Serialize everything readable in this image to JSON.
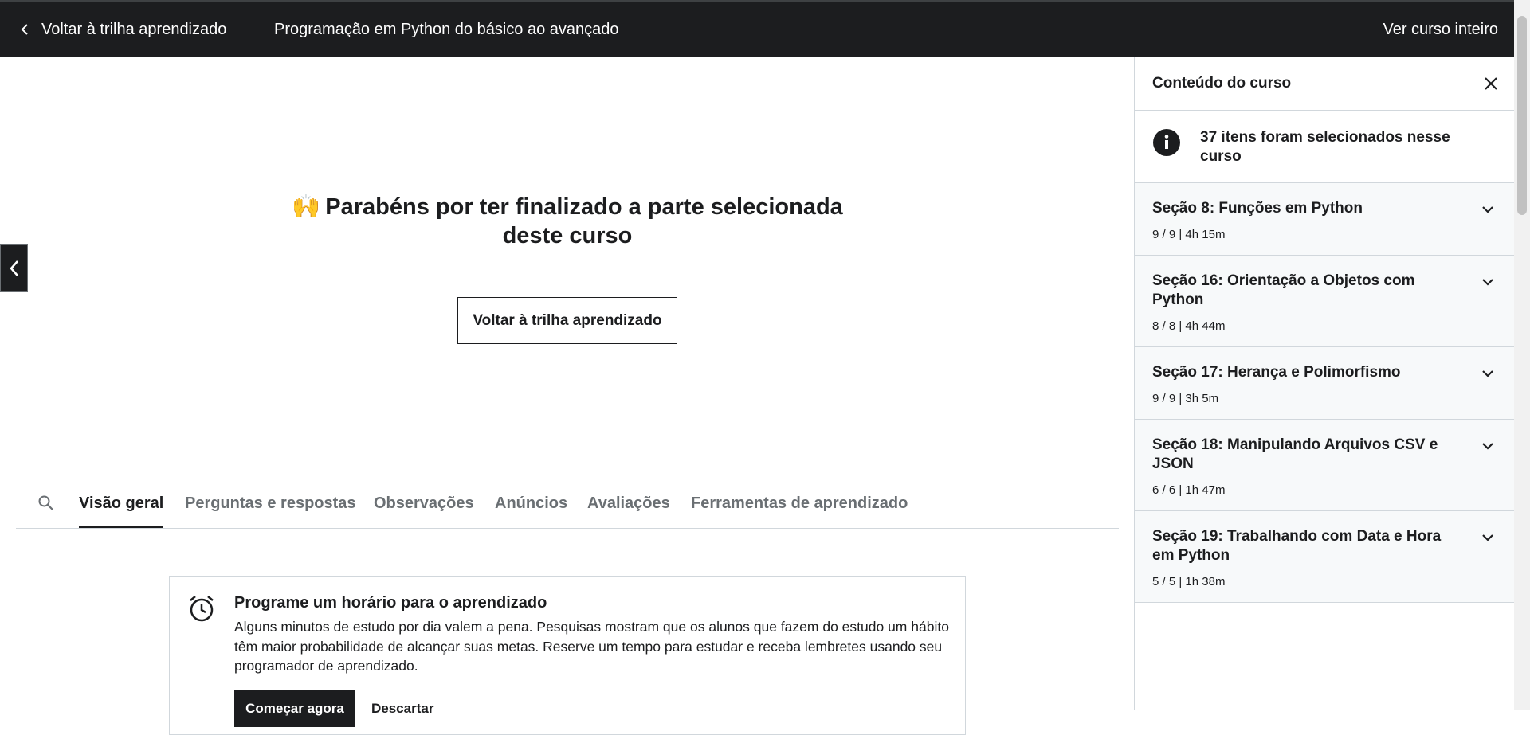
{
  "topbar": {
    "back_label": "Voltar à trilha aprendizado",
    "course_title": "Programação em Python do básico ao avançado",
    "view_all": "Ver curso inteiro"
  },
  "main": {
    "emoji": "🙌",
    "congrats_title": "Parabéns por ter finalizado a parte selecionada deste curso",
    "back_button": "Voltar à trilha aprendizado"
  },
  "tabs": [
    {
      "label": "Visão geral",
      "active": true
    },
    {
      "label": "Perguntas e respostas",
      "active": false
    },
    {
      "label": "Observações",
      "active": false
    },
    {
      "label": "Anúncios",
      "active": false
    },
    {
      "label": "Avaliações",
      "active": false
    },
    {
      "label": "Ferramentas de aprendizado",
      "active": false
    }
  ],
  "reminder": {
    "title": "Programe um horário para o aprendizado",
    "body": "Alguns minutos de estudo por dia valem a pena. Pesquisas mostram que os alunos que fazem do estudo um hábito têm maior probabilidade de alcançar suas metas. Reserve um tempo para estudar e receba lembretes usando seu programador de aprendizado.",
    "start_label": "Começar agora",
    "dismiss_label": "Descartar"
  },
  "sidebar": {
    "title": "Conteúdo do curso",
    "info": "37 itens foram selecionados nesse curso",
    "sections": [
      {
        "title": "Seção 8: Funções em Python",
        "meta": "9 / 9 | 4h 15m"
      },
      {
        "title": "Seção 16: Orientação a Objetos com Python",
        "meta": "8 / 8 | 4h 44m"
      },
      {
        "title": "Seção 17: Herança e Polimorfismo",
        "meta": "9 / 9 | 3h 5m"
      },
      {
        "title": "Seção 18: Manipulando Arquivos CSV e JSON",
        "meta": "6 / 6 | 1h 47m"
      },
      {
        "title": "Seção 19: Trabalhando com Data e Hora em Python",
        "meta": "5 / 5 | 1h 38m"
      }
    ]
  },
  "colors": {
    "topbar_bg": "#1c1d1f",
    "section_bg": "#f7f9fa",
    "border": "#d1d7dc",
    "muted_text": "#6a6f73"
  }
}
